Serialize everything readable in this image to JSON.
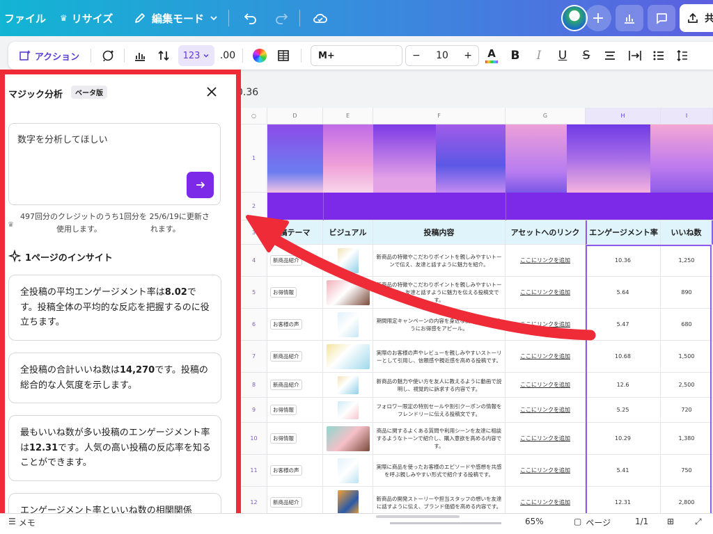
{
  "header": {
    "file_label": "ファイル",
    "resize_label": "リサイズ",
    "edit_mode_label": "編集モード",
    "share_label_partial": "共",
    "colors": {
      "accent": "#7d2ae8",
      "highlight": "#ee2b36"
    }
  },
  "toolbar": {
    "action_label": "アクション",
    "number_format": "123",
    "decimal_label": ".00",
    "font_name": "M+",
    "font_size": "10",
    "minus_label": "−",
    "plus_label": "+"
  },
  "panel": {
    "title": "マジック分析",
    "badge": "ベータ版",
    "query_text": "数字を分析してほしい",
    "credit_line1": "497回分のクレジットのうち1回分を 25/6/19に更新さ",
    "credit_line2": "使用します。                    れます。",
    "insights_heading": "1ページのインサイト",
    "insights": [
      {
        "pre": "全投稿の平均エンゲージメント率は",
        "value": "8.02",
        "post": "です。投稿全体の平均的な反応を把握するのに役立ちます。"
      },
      {
        "pre": "全投稿の合計いいね数は",
        "value": "14,270",
        "post": "です。投稿の総合的な人気度を示します。"
      },
      {
        "pre": "最もいいね数が多い投稿のエンゲージメント率は",
        "value": "12.31",
        "post": "です。人気の高い投稿の反応率を知ることができます。"
      },
      {
        "pre": "エンゲージメント率といいね数の相関関係",
        "value": "",
        "post": ""
      }
    ]
  },
  "document": {
    "title_partial": "0.36"
  },
  "sheet": {
    "columns": [
      "D",
      "E",
      "F",
      "G",
      "H",
      "I"
    ],
    "header_row": {
      "theme": "稿テーマ",
      "visual": "ビジュアル",
      "content": "投稿内容",
      "asset_link": "アセットへのリンク",
      "engagement": "エンゲージメント率",
      "likes": "いいね数"
    },
    "rows": [
      {
        "num": "1"
      },
      {
        "num": "2"
      },
      {
        "num": "3"
      },
      {
        "num": "4",
        "tag": "新商品紹介",
        "content": "新商品の特徴やこだわりポイントを親しみやすいトーンで伝え、友達と話すように魅力を紹介。",
        "link": "ここにリンクを追加",
        "engagement": "10.36",
        "likes": "1,250"
      },
      {
        "num": "5",
        "tag": "お得情報",
        "content": "新商品の特徴やこだわりポイントを親しみやすいトーンで伝え、友達と話すように魅力を伝える投稿文です。",
        "link": "ここにリンクを追加",
        "engagement": "5.64",
        "likes": "890"
      },
      {
        "num": "6",
        "tag": "お客様の声",
        "content": "期間限定キャンペーンの内容を身近な友達に教えるようにお得感をアピール。",
        "link": "ここにリンクを追加",
        "engagement": "5.47",
        "likes": "680"
      },
      {
        "num": "7",
        "tag": "新商品紹介",
        "content": "実際のお客様の声やレビューを親しみやすいストーリーとして引用し、信頼感や親近感を高める投稿です。",
        "link": "ここにリンクを追加",
        "engagement": "10.68",
        "likes": "1,500"
      },
      {
        "num": "8",
        "tag": "新商品紹介",
        "content": "新商品の魅力や使い方を友人に教えるように動画で説明し、視覚的に訴求する内容です。",
        "link": "ここにリンクを追加",
        "engagement": "12.6",
        "likes": "2,500"
      },
      {
        "num": "9",
        "tag": "お得情報",
        "content": "フォロワー限定の特別セールや割引クーポンの情報をフレンドリーに伝える投稿文です。",
        "link": "ここにリンクを追加",
        "engagement": "5.25",
        "likes": "720"
      },
      {
        "num": "10",
        "tag": "お得情報",
        "content": "商品に関するよくある質問や利用シーンを友達に相談するようなトーンで紹介し、購入意欲を高める内容です。",
        "link": "ここにリンクを追加",
        "engagement": "10.29",
        "likes": "1,380"
      },
      {
        "num": "11",
        "tag": "お客様の声",
        "content": "実際に商品を使ったお客様のエピソードや感想を共感を呼ぶ親しみやすい形式で紹介する投稿です。",
        "link": "ここにリンクを追加",
        "engagement": "5.41",
        "likes": "750"
      },
      {
        "num": "12",
        "tag": "新商品紹介",
        "content": "新商品の開発ストーリーや担当スタッフの想いを友達に話すように伝え、ブランド価値を高める内容です。",
        "link": "ここにリンクを追加",
        "engagement": "12.31",
        "likes": "2,800"
      }
    ]
  },
  "statusbar": {
    "notes_label": "メモ",
    "zoom": "65%",
    "pages_label": "ページ",
    "page_count": "1/1"
  }
}
